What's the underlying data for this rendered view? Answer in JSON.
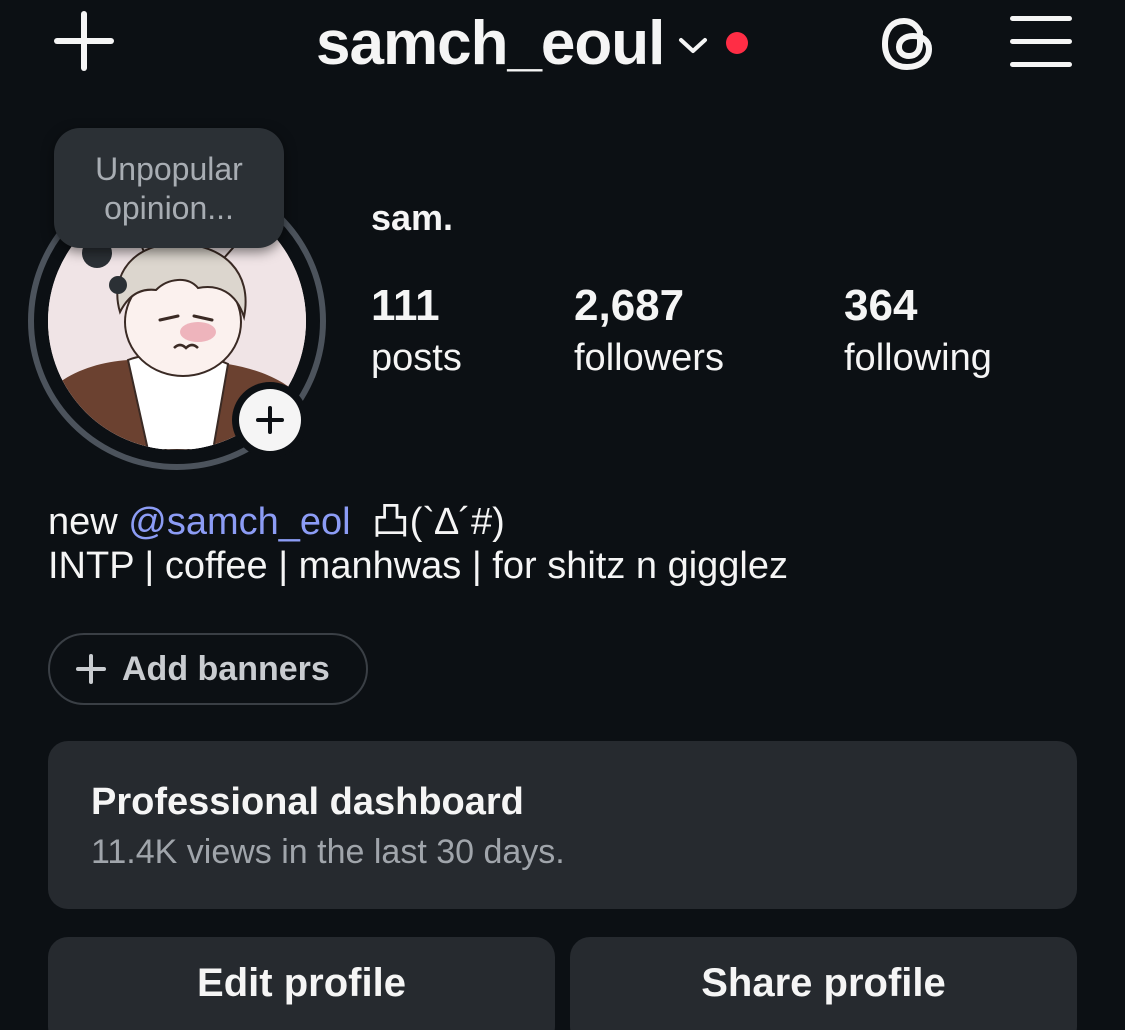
{
  "header": {
    "username": "samch_eoul",
    "notification_color": "#ff2d45",
    "icons": {
      "create": "plus-icon",
      "account_switch": "chevron-down-icon",
      "threads": "threads-icon",
      "menu": "hamburger-menu-icon"
    }
  },
  "profile": {
    "note": "Unpopular opinion...",
    "display_name": "sam.",
    "stats": [
      {
        "value": "111",
        "label": "posts"
      },
      {
        "value": "2,687",
        "label": "followers"
      },
      {
        "value": "364",
        "label": "following"
      }
    ],
    "bio": {
      "prefix": "new ",
      "mention": "@samch_eol",
      "emoticon": "凸(`∆´#)",
      "line2": "INTP | coffee | manhwas | for shitz n gigglez"
    },
    "mention_color": "#8c9cf5"
  },
  "banners": {
    "label": "Add banners"
  },
  "dashboard": {
    "title": "Professional dashboard",
    "subtitle": "11.4K views in the last 30 days."
  },
  "actions": {
    "edit": "Edit profile",
    "share": "Share profile"
  }
}
